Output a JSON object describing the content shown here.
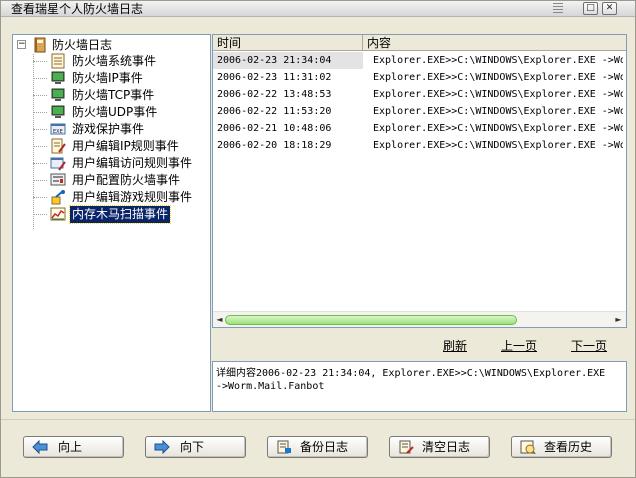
{
  "window": {
    "title": "查看瑞星个人防火墙日志",
    "controls": {
      "maximize_glyph": "□",
      "close_glyph": "✕"
    }
  },
  "tree": {
    "root": {
      "label": "防火墙日志",
      "expander": "−",
      "icon": "log-book-icon"
    },
    "items": [
      {
        "label": "防火墙系统事件",
        "icon": "document-icon"
      },
      {
        "label": "防火墙IP事件",
        "icon": "monitor-icon"
      },
      {
        "label": "防火墙TCP事件",
        "icon": "monitor-icon"
      },
      {
        "label": "防火墙UDP事件",
        "icon": "monitor-icon"
      },
      {
        "label": "游戏保护事件",
        "icon": "exe-icon"
      },
      {
        "label": "用户编辑IP规则事件",
        "icon": "document-edit-icon"
      },
      {
        "label": "用户编辑访问规则事件",
        "icon": "exe-edit-icon"
      },
      {
        "label": "用户配置防火墙事件",
        "icon": "settings-panel-icon"
      },
      {
        "label": "用户编辑游戏规则事件",
        "icon": "tools-icon"
      },
      {
        "label": "内存木马扫描事件",
        "icon": "scan-chart-icon",
        "selected": true
      }
    ]
  },
  "log_table": {
    "columns": {
      "time": "时间",
      "content": "内容"
    },
    "rows": [
      {
        "time": "2006-02-23 21:34:04",
        "content": "Explorer.EXE>>C:\\WINDOWS\\Explorer.EXE ->Wor"
      },
      {
        "time": "2006-02-23 11:31:02",
        "content": "Explorer.EXE>>C:\\WINDOWS\\Explorer.EXE ->Wor"
      },
      {
        "time": "2006-02-22 13:48:53",
        "content": "Explorer.EXE>>C:\\WINDOWS\\Explorer.EXE ->Wor"
      },
      {
        "time": "2006-02-22 11:53:20",
        "content": "Explorer.EXE>>C:\\WINDOWS\\Explorer.EXE ->Wor"
      },
      {
        "time": "2006-02-21 10:48:06",
        "content": "Explorer.EXE>>C:\\WINDOWS\\Explorer.EXE ->Wor"
      },
      {
        "time": "2006-02-20 18:18:29",
        "content": "Explorer.EXE>>C:\\WINDOWS\\Explorer.EXE ->Wor"
      }
    ],
    "scroll": {
      "left_arrow": "◄",
      "right_arrow": "►"
    }
  },
  "pager": {
    "refresh": "刷新",
    "prev_page": "上一页",
    "next_page": "下一页"
  },
  "detail": {
    "line1": "详细内容2006-02-23 21:34:04, Explorer.EXE>>C:\\WINDOWS\\Explorer.EXE",
    "line2": "->Worm.Mail.Fanbot"
  },
  "buttons": {
    "up": {
      "label": "向上",
      "icon": "arrow-left-icon"
    },
    "down": {
      "label": "向下",
      "icon": "arrow-right-icon"
    },
    "backup": {
      "label": "备份日志",
      "icon": "backup-icon"
    },
    "clear": {
      "label": "清空日志",
      "icon": "clear-icon"
    },
    "history": {
      "label": "查看历史",
      "icon": "history-icon"
    }
  },
  "colors": {
    "window_bg": "#ece9d8",
    "selection_bg": "#0a246a",
    "panel_border": "#7f9db9",
    "scroll_thumb": "#9fdf7c"
  }
}
